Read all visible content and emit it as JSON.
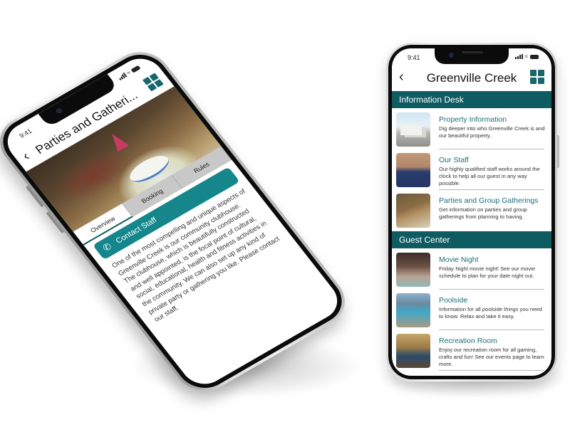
{
  "right_phone": {
    "status_bar": {
      "time": "9:41"
    },
    "header": {
      "back_icon": "chevron-left",
      "title": "Greenville Creek",
      "menu_icon": "grid-icon"
    },
    "sections": [
      {
        "title": "Information Desk",
        "items": [
          {
            "title": "Property Information",
            "description": "Dig deeper into who Greenville Creek is and our beautiful property.",
            "thumbnail": "property-photo"
          },
          {
            "title": "Our Staff",
            "description": "Our highly qualified staff works around the clock to help all our guest in any way possible.",
            "thumbnail": "staff-photo"
          },
          {
            "title": "Parties and Group Gatherings",
            "description": "Get information on parties and group gatherings from planning to having.",
            "thumbnail": "party-photo"
          }
        ]
      },
      {
        "title": "Guest Center",
        "items": [
          {
            "title": "Movie Night",
            "description": "Friday Night movie night! See our movie schedule to plan for your date night out.",
            "thumbnail": "movie-photo"
          },
          {
            "title": "Poolside",
            "description": "Information for all poolside things you need to know. Relax and take it easy.",
            "thumbnail": "pool-photo"
          },
          {
            "title": "Recreation Room",
            "description": "Enjoy our recreation room for all gaming, crafts and fun! See our events page to learn more.",
            "thumbnail": "recreation-photo"
          }
        ]
      }
    ]
  },
  "left_phone": {
    "status_bar": {
      "time": "9:41"
    },
    "header": {
      "back_icon": "chevron-left",
      "title": "Parties and Gatheri...",
      "menu_icon": "grid-icon"
    },
    "hero_image": "birthday-party-photo",
    "tabs": [
      {
        "label": "Overview",
        "active": true
      },
      {
        "label": "Booking",
        "active": false
      },
      {
        "label": "Rules",
        "active": false
      }
    ],
    "contact_button": {
      "label": "Contact Staff",
      "icon": "phone-icon"
    },
    "body_text": "One of the most compelling and unique aspects of Greenville Creek is our community clubhouse. The clubhouse, which is beautifully constructed and well appointed, is the focal point of cultural, social, educational, health and fitness activities in the community. We can also set up any kind of private party or gathering you like. Please contact our staff."
  },
  "colors": {
    "teal_dark": "#0f5b62",
    "teal_button": "#14868c",
    "teal_text": "#1b6e76"
  }
}
